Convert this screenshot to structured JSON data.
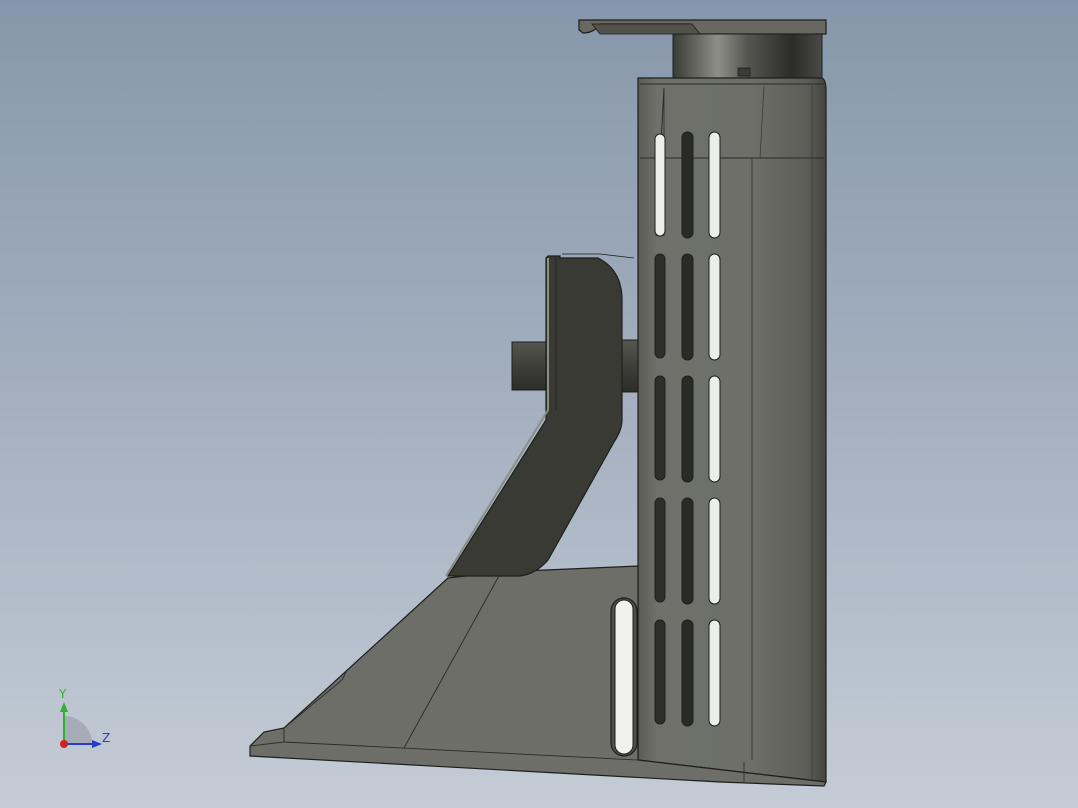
{
  "viewport": {
    "view_name": "side-view",
    "background_top": "#8797ab",
    "background_bottom": "#c4ccd6"
  },
  "model": {
    "body_color": "#6d6e68",
    "dark_color": "#3b3c36",
    "shadow_color": "#4d4e48",
    "edge_color": "#1e1f1b"
  },
  "triad": {
    "y_label": "Y",
    "z_label": "Z",
    "y_color": "#2db22d",
    "z_color": "#2a3ec4",
    "origin_color": "#d42020"
  }
}
